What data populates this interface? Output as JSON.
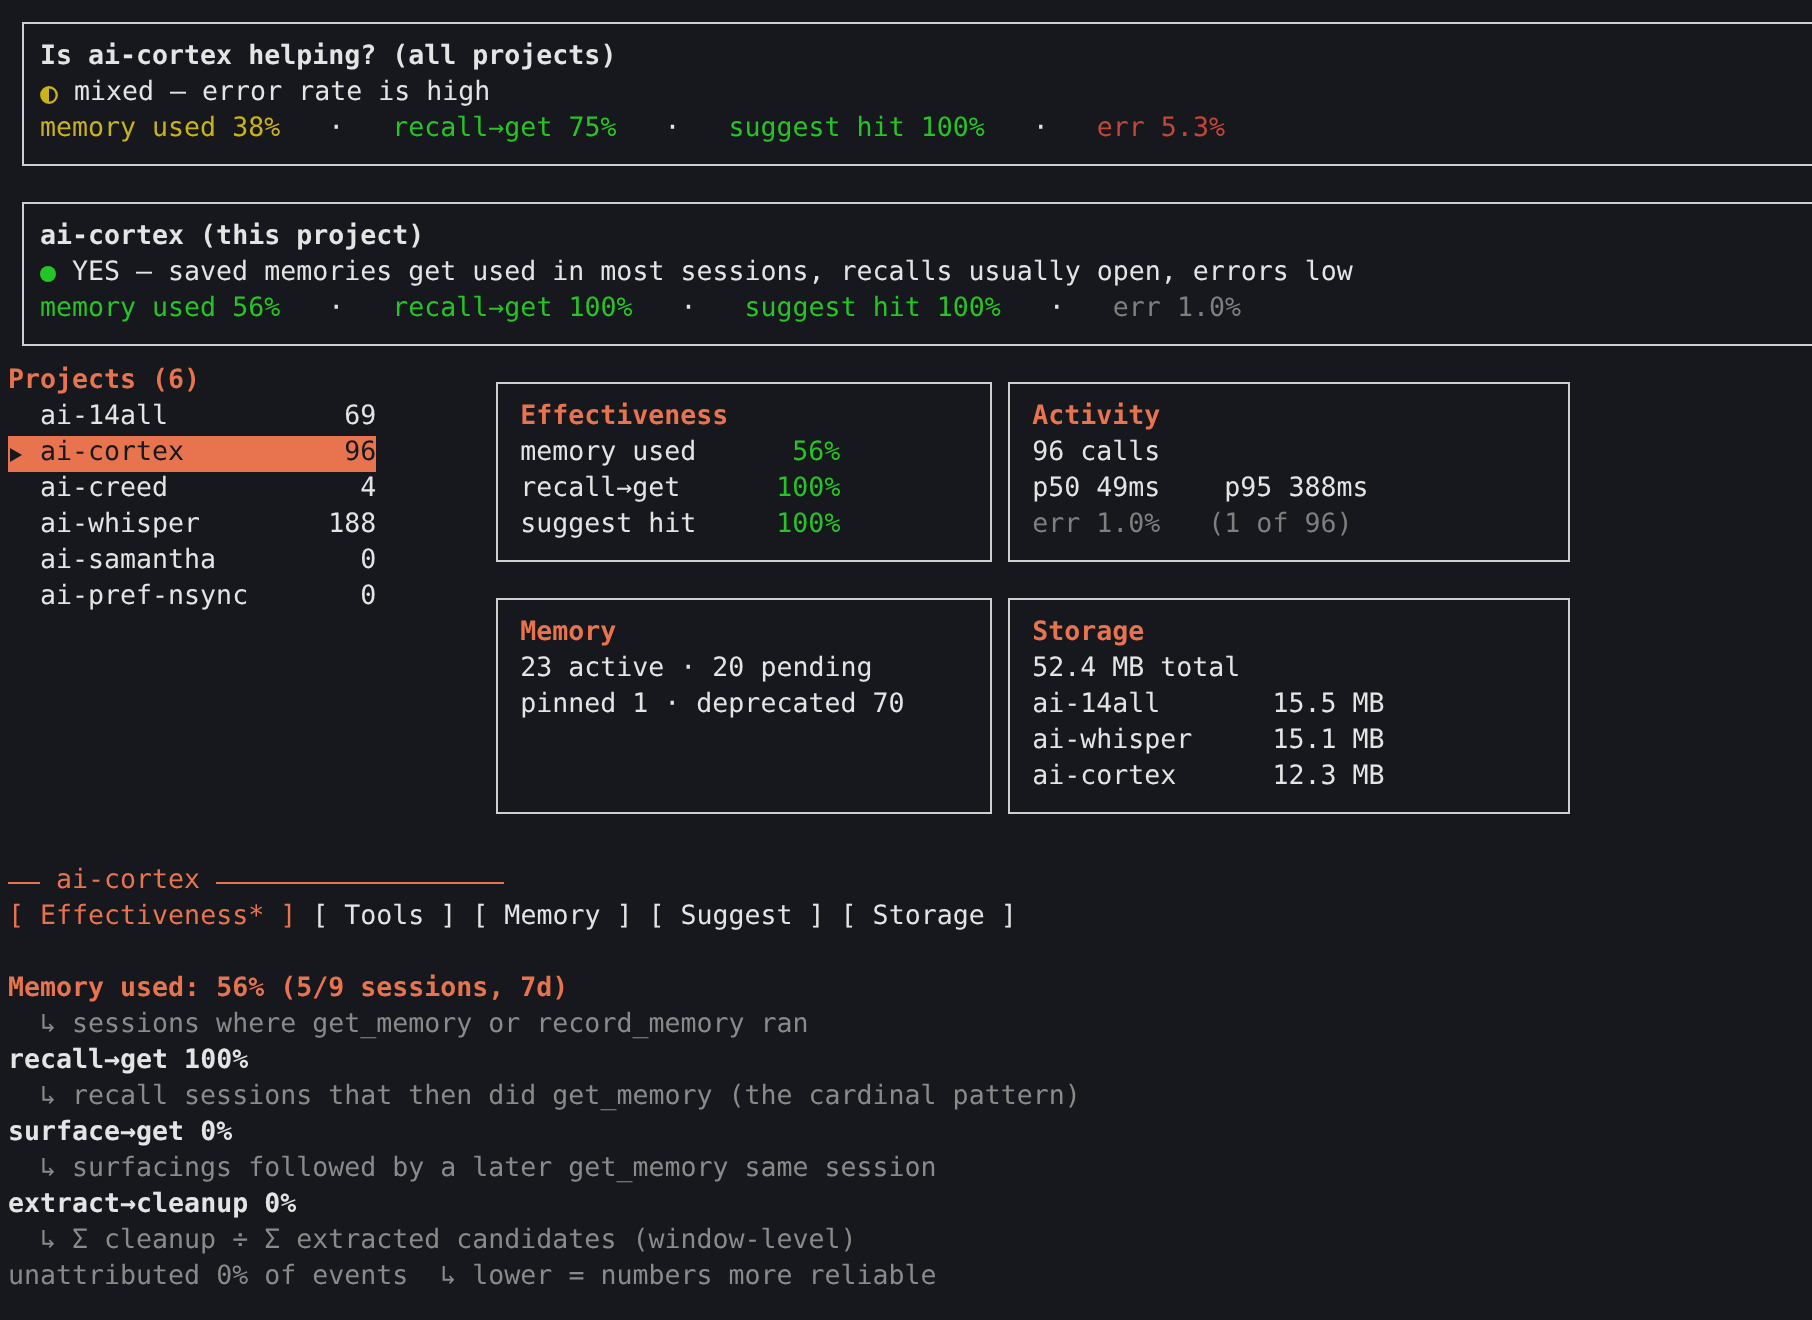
{
  "summaries": [
    {
      "title": "Is ai-cortex helping? (all projects)",
      "verdict": {
        "kind": "half",
        "color": "#c9b31c",
        "text": "mixed — error rate is high"
      },
      "items": [
        {
          "kind": "metric",
          "text": "memory used 38%",
          "color": "#c9b31c"
        },
        {
          "kind": "separator",
          "text": "·"
        },
        {
          "kind": "metric",
          "text": "recall→get 75%",
          "color": "#27c427"
        },
        {
          "kind": "separator",
          "text": "·"
        },
        {
          "kind": "metric",
          "text": "suggest hit 100%",
          "color": "#27c427"
        },
        {
          "kind": "separator",
          "text": "·"
        },
        {
          "kind": "metric",
          "text": "err 5.3%",
          "color": "#c2473a"
        }
      ]
    },
    {
      "title": "ai-cortex (this project)",
      "verdict": {
        "kind": "dot",
        "color": "#27c427",
        "text": "YES — saved memories get used in most sessions, recalls usually open, errors low"
      },
      "items": [
        {
          "kind": "metric",
          "text": "memory used 56%",
          "color": "#27c427"
        },
        {
          "kind": "separator",
          "text": "·"
        },
        {
          "kind": "metric",
          "text": "recall→get 100%",
          "color": "#27c427"
        },
        {
          "kind": "separator",
          "text": "·"
        },
        {
          "kind": "metric",
          "text": "suggest hit 100%",
          "color": "#27c427"
        },
        {
          "kind": "separator",
          "text": "·"
        },
        {
          "kind": "metric",
          "text": "err 1.0%",
          "color": "#7f7f7f"
        }
      ]
    }
  ],
  "projects": {
    "title": "Projects (6)",
    "items": [
      {
        "name": "ai-14all",
        "count": "69",
        "selected": false
      },
      {
        "name": "ai-cortex",
        "count": "96",
        "selected": true
      },
      {
        "name": "ai-creed",
        "count": "4",
        "selected": false
      },
      {
        "name": "ai-whisper",
        "count": "188",
        "selected": false
      },
      {
        "name": "ai-samantha",
        "count": "0",
        "selected": false
      },
      {
        "name": "ai-pref-nsync",
        "count": "0",
        "selected": false
      }
    ]
  },
  "panels": [
    {
      "title": "Effectiveness",
      "rows": [
        {
          "kind": "stat",
          "label": "memory used",
          "value": "56%",
          "color": "#27c427"
        },
        {
          "kind": "stat",
          "label": "recall→get",
          "value": "100%",
          "color": "#27c427"
        },
        {
          "kind": "stat",
          "label": "suggest hit",
          "value": "100%",
          "color": "#27c427"
        }
      ]
    },
    {
      "title": "Activity",
      "rows": [
        {
          "kind": "line",
          "text": "96 calls",
          "muted": false
        },
        {
          "kind": "line",
          "text": "p50 49ms    p95 388ms",
          "muted": false
        },
        {
          "kind": "line",
          "text": "err 1.0%   (1 of 96)",
          "muted": true
        }
      ]
    },
    {
      "title": "Memory",
      "rows": [
        {
          "kind": "line",
          "text": "23 active · 20 pending",
          "muted": false
        },
        {
          "kind": "line",
          "text": "pinned 1 · deprecated 70",
          "muted": false
        }
      ]
    },
    {
      "title": "Storage",
      "rows": [
        {
          "kind": "line",
          "text": "52.4 MB total",
          "muted": false
        },
        {
          "kind": "size",
          "name": "ai-14all",
          "size": "15.5 MB"
        },
        {
          "kind": "size",
          "name": "ai-whisper",
          "size": "15.1 MB"
        },
        {
          "kind": "size",
          "name": "ai-cortex",
          "size": "12.3 MB"
        }
      ]
    }
  ],
  "detail": {
    "title": "ai-cortex",
    "tabs": [
      {
        "label": "[ Effectiveness* ]",
        "selected": true
      },
      {
        "label": "[ Tools ]",
        "selected": false
      },
      {
        "label": "[ Memory ]",
        "selected": false
      },
      {
        "label": "[ Suggest ]",
        "selected": false
      },
      {
        "label": "[ Storage ]",
        "selected": false
      }
    ],
    "lines": [
      {
        "kind": "heading",
        "text": "Memory used: 56% (5/9 sessions, 7d)",
        "accent": true
      },
      {
        "kind": "note",
        "text": "↳ sessions where get_memory or record_memory ran"
      },
      {
        "kind": "heading",
        "text": "recall→get 100%",
        "accent": false
      },
      {
        "kind": "note",
        "text": "↳ recall sessions that then did get_memory (the cardinal pattern)"
      },
      {
        "kind": "heading",
        "text": "surface→get 0%",
        "accent": false
      },
      {
        "kind": "note",
        "text": "↳ surfacings followed by a later get_memory same session"
      },
      {
        "kind": "heading",
        "text": "extract→cleanup 0%",
        "accent": false
      },
      {
        "kind": "note",
        "text": "↳ Σ cleanup ÷ Σ extracted candidates (window-level)"
      },
      {
        "kind": "footer",
        "text": "unattributed 0% of events  ↳ lower = numbers more reliable"
      }
    ]
  }
}
